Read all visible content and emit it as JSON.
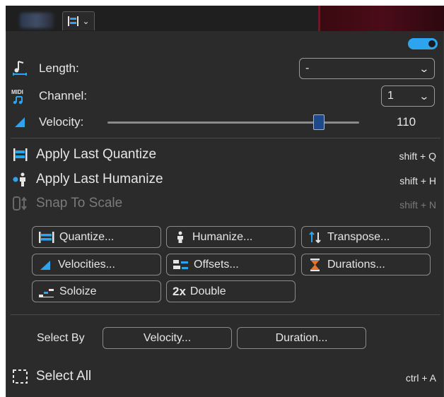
{
  "top_button": {
    "chevron": "⌄"
  },
  "length": {
    "label": "Length:",
    "value": "-"
  },
  "channel": {
    "label": "Channel:",
    "value": "1"
  },
  "velocity": {
    "label": "Velocity:",
    "value": "110",
    "fraction": 0.84
  },
  "commands": [
    {
      "label": "Apply Last Quantize",
      "shortcut": "shift + Q",
      "icon": "quantize-icon",
      "enabled": true
    },
    {
      "label": "Apply Last Humanize",
      "shortcut": "shift + H",
      "icon": "humanize-icon",
      "enabled": true
    },
    {
      "label": "Snap To Scale",
      "shortcut": "shift + N",
      "icon": "scale-icon",
      "enabled": false
    }
  ],
  "buttons": {
    "quantize": "Quantize...",
    "humanize": "Humanize...",
    "transpose": "Transpose...",
    "velocities": "Velocities...",
    "offsets": "Offsets...",
    "durations": "Durations...",
    "soloize": "Soloize",
    "double": "Double",
    "double_prefix": "2x"
  },
  "select_by": {
    "label": "Select By",
    "velocity": "Velocity...",
    "duration": "Duration..."
  },
  "select_all": {
    "label": "Select All",
    "shortcut": "ctrl + A"
  },
  "colors": {
    "accent": "#2da4f0",
    "panel": "#2b2b2b"
  }
}
